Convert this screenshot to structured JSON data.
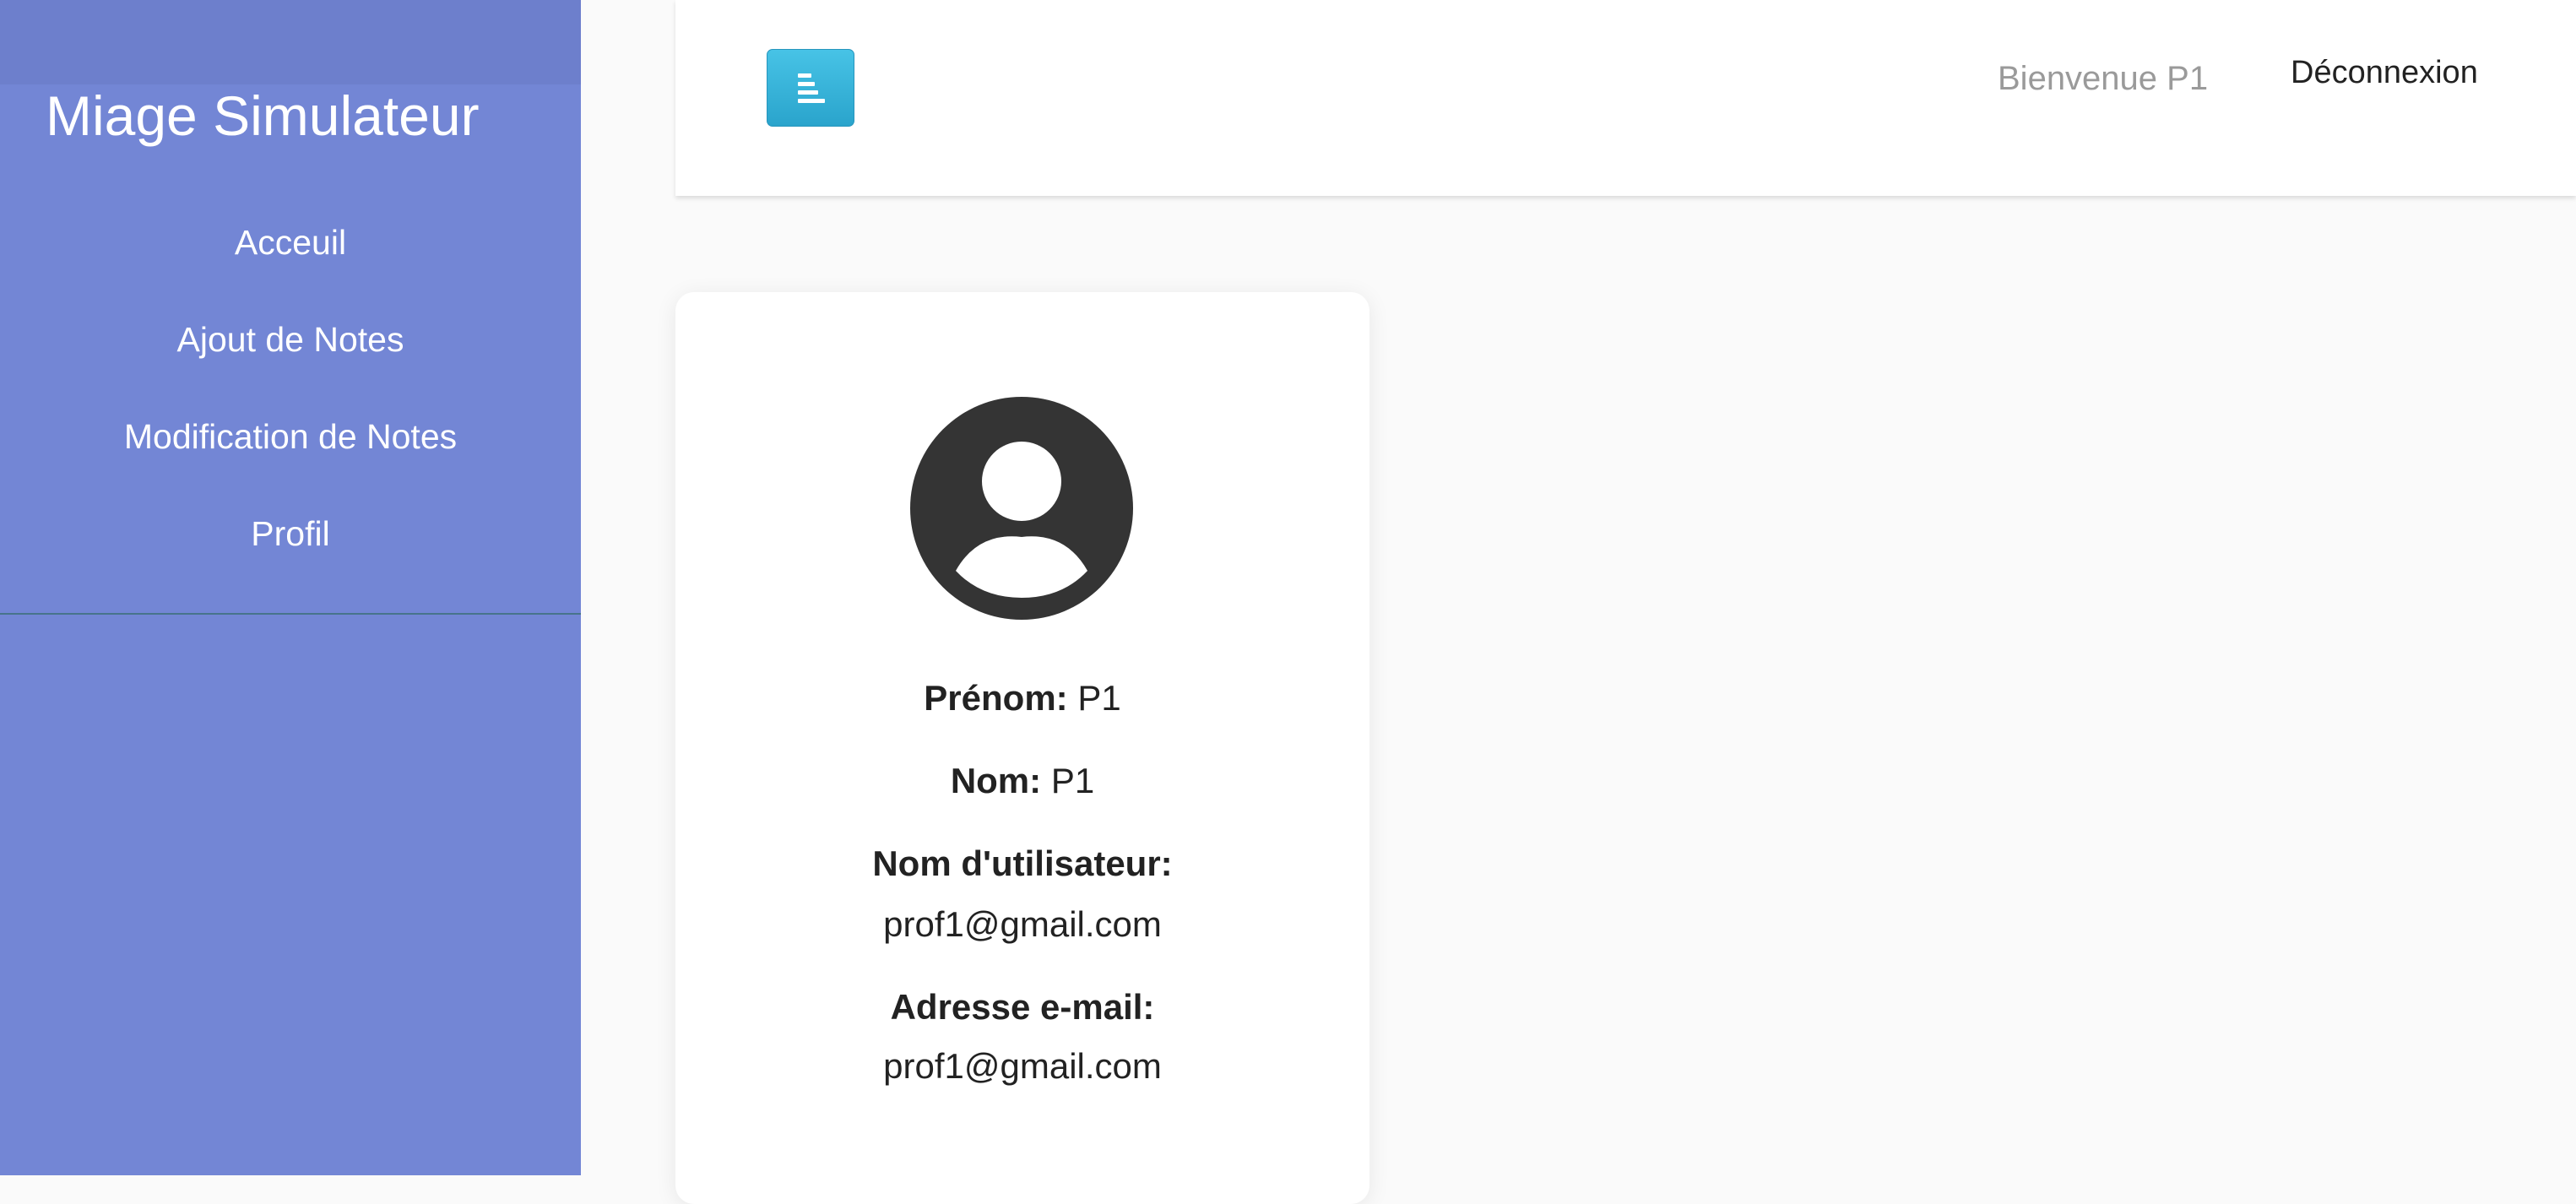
{
  "sidebar": {
    "title": "Miage Simulateur",
    "items": [
      {
        "label": "Acceuil"
      },
      {
        "label": "Ajout de Notes"
      },
      {
        "label": "Modification de Notes"
      },
      {
        "label": "Profil"
      }
    ]
  },
  "header": {
    "welcome": "Bienvenue P1",
    "logout_label": "Déconnexion",
    "toggle_icon": "align-left-icon"
  },
  "profile": {
    "avatar_icon": "user-circle-icon",
    "prenom_label": "Prénom:",
    "prenom_value": "P1",
    "nom_label": "Nom:",
    "nom_value": "P1",
    "username_label": "Nom d'utilisateur:",
    "username_value": "prof1@gmail.com",
    "email_label": "Adresse e-mail:",
    "email_value": "prof1@gmail.com"
  },
  "colors": {
    "sidebar_bg": "#7386d5",
    "toggle_button": "#3ab4dc",
    "avatar": "#343434"
  }
}
